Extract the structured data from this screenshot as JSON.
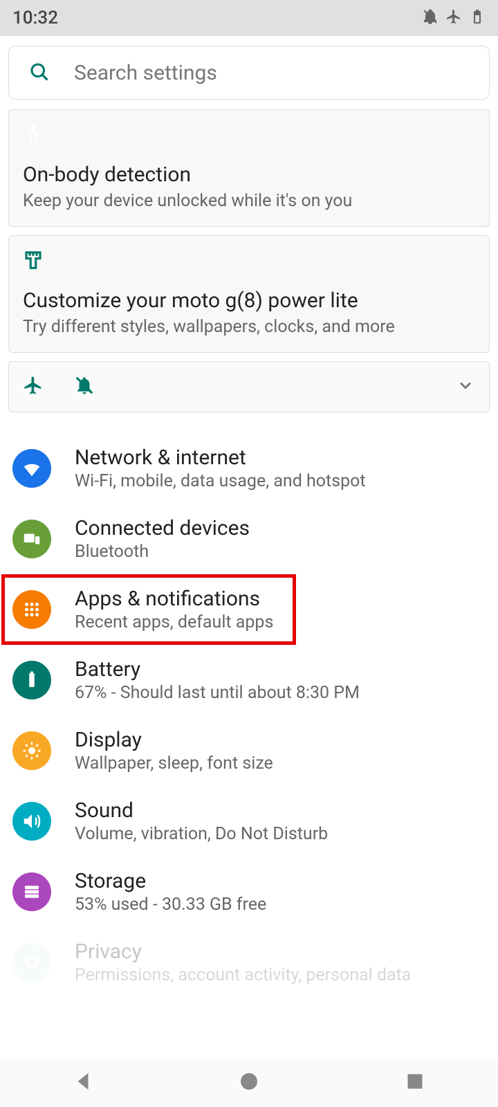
{
  "status": {
    "time": "10:32"
  },
  "search": {
    "placeholder": "Search settings"
  },
  "cards": {
    "onbody": {
      "title": "On-body detection",
      "sub": "Keep your device unlocked while it's on you"
    },
    "customize": {
      "title": "Customize your moto g(8) power lite",
      "sub": "Try different styles, wallpapers, clocks, and more"
    }
  },
  "settings": {
    "network": {
      "title": "Network & internet",
      "sub": "Wi-Fi, mobile, data usage, and hotspot"
    },
    "connected": {
      "title": "Connected devices",
      "sub": "Bluetooth"
    },
    "apps": {
      "title": "Apps & notifications",
      "sub": "Recent apps, default apps"
    },
    "battery": {
      "title": "Battery",
      "sub": "67% - Should last until about 8:30 PM"
    },
    "display": {
      "title": "Display",
      "sub": "Wallpaper, sleep, font size"
    },
    "sound": {
      "title": "Sound",
      "sub": "Volume, vibration, Do Not Disturb"
    },
    "storage": {
      "title": "Storage",
      "sub": "53% used - 30.33 GB free"
    },
    "privacy": {
      "title": "Privacy",
      "sub": "Permissions, account activity, personal data"
    }
  }
}
